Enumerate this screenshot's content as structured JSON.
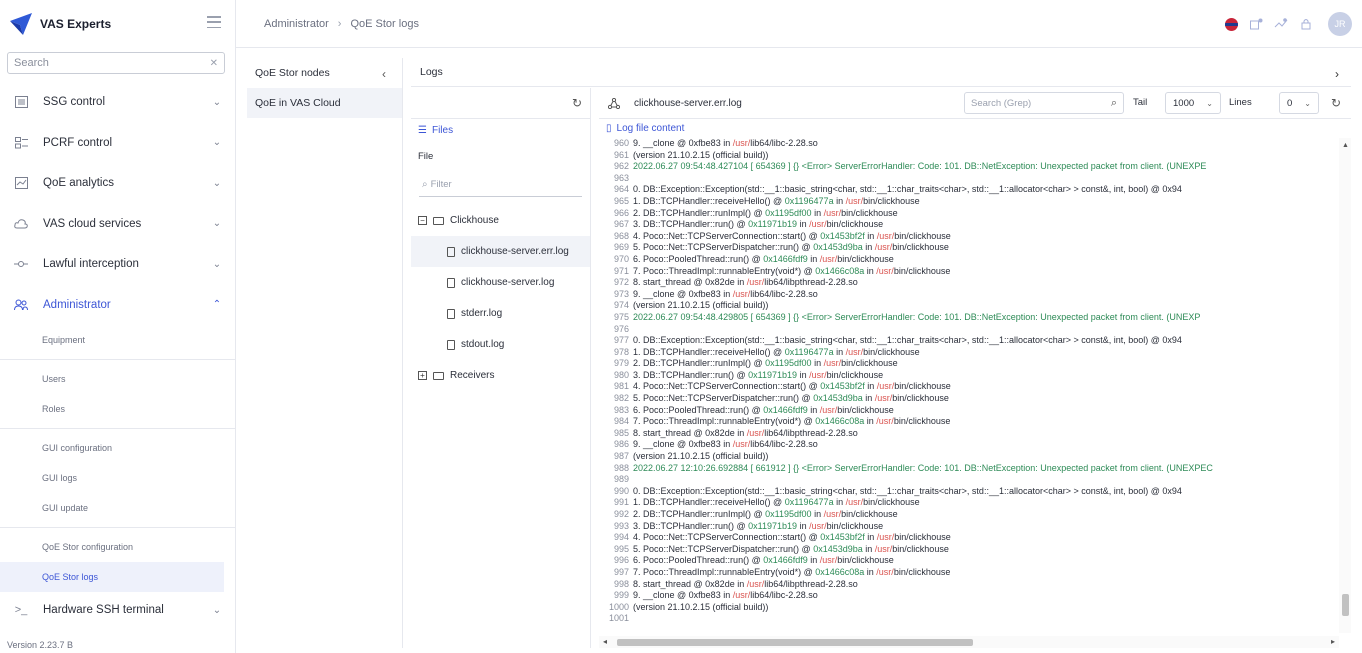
{
  "brand": {
    "name": "VAS Experts"
  },
  "sidebar": {
    "search_placeholder": "Search",
    "items": [
      {
        "label": "SSG control",
        "icon": "list-icon"
      },
      {
        "label": "PCRF control",
        "icon": "sliders-icon"
      },
      {
        "label": "QoE analytics",
        "icon": "chart-icon"
      },
      {
        "label": "VAS cloud services",
        "icon": "cloud-icon"
      },
      {
        "label": "Lawful interception",
        "icon": "signal-icon"
      },
      {
        "label": "Administrator",
        "icon": "users-icon"
      }
    ],
    "admin_sub": [
      {
        "label": "Equipment"
      },
      {
        "label": "Users"
      },
      {
        "label": "Roles"
      },
      {
        "label": "GUI configuration"
      },
      {
        "label": "GUI logs"
      },
      {
        "label": "GUI update"
      },
      {
        "label": "QoE Stor configuration"
      },
      {
        "label": "QoE Stor logs"
      }
    ],
    "terminal_label": "Hardware SSH terminal",
    "version": "Version 2.23.7 B"
  },
  "header": {
    "breadcrumb_parent": "Administrator",
    "breadcrumb_current": "QoE Stor logs",
    "avatar_initials": "JR"
  },
  "nodes": {
    "title": "QoE Stor nodes",
    "items": [
      "QoE in VAS Cloud"
    ]
  },
  "logs": {
    "title": "Logs",
    "files_tab": "Files",
    "file_label": "File",
    "filter_placeholder": "Filter",
    "tree": {
      "folder1": "Clickhouse",
      "files": [
        "clickhouse-server.err.log",
        "clickhouse-server.log",
        "stderr.log",
        "stdout.log"
      ],
      "folder2": "Receivers"
    },
    "viewer": {
      "file_name": "clickhouse-server.err.log",
      "grep_placeholder": "Search (Grep)",
      "tail_label": "Tail",
      "tail_value": "1000",
      "lines_label": "Lines",
      "lines_value": "0",
      "content_tab": "Log file content"
    }
  },
  "log_lines": [
    {
      "n": "960",
      "parts": [
        [
          "9. __clone @ 0xfbe83 in ",
          ""
        ],
        [
          "/usr/",
          "red"
        ],
        [
          "lib64/libc-2.28.so",
          ""
        ]
      ]
    },
    {
      "n": "961",
      "parts": [
        [
          "(version 21.10.2.15 (official build))",
          ""
        ]
      ]
    },
    {
      "n": "962",
      "parts": [
        [
          "2022.06.27 09:54:48.427104 [ 654369 ] {} <Error> ServerErrorHandler: Code: 101. DB::NetException: Unexpected packet from client. (UNEXPE",
          ""
        ]
      ]
    },
    {
      "n": "963",
      "parts": [
        [
          "",
          ""
        ]
      ]
    },
    {
      "n": "964",
      "parts": [
        [
          "0. DB::Exception::Exception(std::__1::basic_string<char, std::__1::char_traits<char>, std::__1::allocator<char> > const&, int, bool) @ 0x94",
          ""
        ]
      ]
    },
    {
      "n": "965",
      "parts": [
        [
          "1. DB::TCPHandler::receiveHello() @ ",
          ""
        ],
        [
          "0x1196477a",
          "green"
        ],
        [
          " in ",
          ""
        ],
        [
          "/usr/",
          "red"
        ],
        [
          "bin/clickhouse",
          ""
        ]
      ]
    },
    {
      "n": "966",
      "parts": [
        [
          "2. DB::TCPHandler::runImpl() @ ",
          ""
        ],
        [
          "0x1195df00",
          "green"
        ],
        [
          " in ",
          ""
        ],
        [
          "/usr/",
          "red"
        ],
        [
          "bin/clickhouse",
          ""
        ]
      ]
    },
    {
      "n": "967",
      "parts": [
        [
          "3. DB::TCPHandler::run() @ ",
          ""
        ],
        [
          "0x11971b19",
          "green"
        ],
        [
          " in ",
          ""
        ],
        [
          "/usr/",
          "red"
        ],
        [
          "bin/clickhouse",
          ""
        ]
      ]
    },
    {
      "n": "968",
      "parts": [
        [
          "4. Poco::Net::TCPServerConnection::start() @ ",
          ""
        ],
        [
          "0x1453bf2f",
          "green"
        ],
        [
          " in ",
          ""
        ],
        [
          "/usr/",
          "red"
        ],
        [
          "bin/clickhouse",
          ""
        ]
      ]
    },
    {
      "n": "969",
      "parts": [
        [
          "5. Poco::Net::TCPServerDispatcher::run() @ ",
          ""
        ],
        [
          "0x1453d9ba",
          "green"
        ],
        [
          " in ",
          ""
        ],
        [
          "/usr/",
          "red"
        ],
        [
          "bin/clickhouse",
          ""
        ]
      ]
    },
    {
      "n": "970",
      "parts": [
        [
          "6. Poco::PooledThread::run() @ ",
          ""
        ],
        [
          "0x1466fdf9",
          "green"
        ],
        [
          " in ",
          ""
        ],
        [
          "/usr/",
          "red"
        ],
        [
          "bin/clickhouse",
          ""
        ]
      ]
    },
    {
      "n": "971",
      "parts": [
        [
          "7. Poco::ThreadImpl::runnableEntry(void*) @ ",
          ""
        ],
        [
          "0x1466c08a",
          "green"
        ],
        [
          " in ",
          ""
        ],
        [
          "/usr/",
          "red"
        ],
        [
          "bin/clickhouse",
          ""
        ]
      ]
    },
    {
      "n": "972",
      "parts": [
        [
          "8. start_thread @ 0x82de in ",
          ""
        ],
        [
          "/usr/",
          "red"
        ],
        [
          "lib64/libpthread-2.28.so",
          ""
        ]
      ]
    },
    {
      "n": "973",
      "parts": [
        [
          "9. __clone @ 0xfbe83 in ",
          ""
        ],
        [
          "/usr/",
          "red"
        ],
        [
          "lib64/libc-2.28.so",
          ""
        ]
      ]
    },
    {
      "n": "974",
      "parts": [
        [
          "(version 21.10.2.15 (official build))",
          ""
        ]
      ]
    },
    {
      "n": "975",
      "parts": [
        [
          "2022.06.27 09:54:48.429805 [ 654369 ] {} <Error> ServerErrorHandler: Code: 101. DB::NetException: Unexpected packet from client. (UNEXP",
          ""
        ]
      ]
    },
    {
      "n": "976",
      "parts": [
        [
          "",
          ""
        ]
      ]
    },
    {
      "n": "977",
      "parts": [
        [
          "0. DB::Exception::Exception(std::__1::basic_string<char, std::__1::char_traits<char>, std::__1::allocator<char> > const&, int, bool) @ 0x94",
          ""
        ]
      ]
    },
    {
      "n": "978",
      "parts": [
        [
          "1. DB::TCPHandler::receiveHello() @ ",
          ""
        ],
        [
          "0x1196477a",
          "green"
        ],
        [
          " in ",
          ""
        ],
        [
          "/usr/",
          "red"
        ],
        [
          "bin/clickhouse",
          ""
        ]
      ]
    },
    {
      "n": "979",
      "parts": [
        [
          "2. DB::TCPHandler::runImpl() @ ",
          ""
        ],
        [
          "0x1195df00",
          "green"
        ],
        [
          " in ",
          ""
        ],
        [
          "/usr/",
          "red"
        ],
        [
          "bin/clickhouse",
          ""
        ]
      ]
    },
    {
      "n": "980",
      "parts": [
        [
          "3. DB::TCPHandler::run() @ ",
          ""
        ],
        [
          "0x11971b19",
          "green"
        ],
        [
          " in ",
          ""
        ],
        [
          "/usr/",
          "red"
        ],
        [
          "bin/clickhouse",
          ""
        ]
      ]
    },
    {
      "n": "981",
      "parts": [
        [
          "4. Poco::Net::TCPServerConnection::start() @ ",
          ""
        ],
        [
          "0x1453bf2f",
          "green"
        ],
        [
          " in ",
          ""
        ],
        [
          "/usr/",
          "red"
        ],
        [
          "bin/clickhouse",
          ""
        ]
      ]
    },
    {
      "n": "982",
      "parts": [
        [
          "5. Poco::Net::TCPServerDispatcher::run() @ ",
          ""
        ],
        [
          "0x1453d9ba",
          "green"
        ],
        [
          " in ",
          ""
        ],
        [
          "/usr/",
          "red"
        ],
        [
          "bin/clickhouse",
          ""
        ]
      ]
    },
    {
      "n": "983",
      "parts": [
        [
          "6. Poco::PooledThread::run() @ ",
          ""
        ],
        [
          "0x1466fdf9",
          "green"
        ],
        [
          " in ",
          ""
        ],
        [
          "/usr/",
          "red"
        ],
        [
          "bin/clickhouse",
          ""
        ]
      ]
    },
    {
      "n": "984",
      "parts": [
        [
          "7. Poco::ThreadImpl::runnableEntry(void*) @ ",
          ""
        ],
        [
          "0x1466c08a",
          "green"
        ],
        [
          " in ",
          ""
        ],
        [
          "/usr/",
          "red"
        ],
        [
          "bin/clickhouse",
          ""
        ]
      ]
    },
    {
      "n": "985",
      "parts": [
        [
          "8. start_thread @ 0x82de in ",
          ""
        ],
        [
          "/usr/",
          "red"
        ],
        [
          "lib64/libpthread-2.28.so",
          ""
        ]
      ]
    },
    {
      "n": "986",
      "parts": [
        [
          "9. __clone @ 0xfbe83 in ",
          ""
        ],
        [
          "/usr/",
          "red"
        ],
        [
          "lib64/libc-2.28.so",
          ""
        ]
      ]
    },
    {
      "n": "987",
      "parts": [
        [
          "(version 21.10.2.15 (official build))",
          ""
        ]
      ]
    },
    {
      "n": "988",
      "parts": [
        [
          "2022.06.27 12:10:26.692884 [ 661912 ] {} <Error> ServerErrorHandler: Code: 101. DB::NetException: Unexpected packet from client. (UNEXPEC",
          ""
        ]
      ]
    },
    {
      "n": "989",
      "parts": [
        [
          "",
          ""
        ]
      ]
    },
    {
      "n": "990",
      "parts": [
        [
          "0. DB::Exception::Exception(std::__1::basic_string<char, std::__1::char_traits<char>, std::__1::allocator<char> > const&, int, bool) @ 0x94",
          ""
        ]
      ]
    },
    {
      "n": "991",
      "parts": [
        [
          "1. DB::TCPHandler::receiveHello() @ ",
          ""
        ],
        [
          "0x1196477a",
          "green"
        ],
        [
          " in ",
          ""
        ],
        [
          "/usr/",
          "red"
        ],
        [
          "bin/clickhouse",
          ""
        ]
      ]
    },
    {
      "n": "992",
      "parts": [
        [
          "2. DB::TCPHandler::runImpl() @ ",
          ""
        ],
        [
          "0x1195df00",
          "green"
        ],
        [
          " in ",
          ""
        ],
        [
          "/usr/",
          "red"
        ],
        [
          "bin/clickhouse",
          ""
        ]
      ]
    },
    {
      "n": "993",
      "parts": [
        [
          "3. DB::TCPHandler::run() @ ",
          ""
        ],
        [
          "0x11971b19",
          "green"
        ],
        [
          " in ",
          ""
        ],
        [
          "/usr/",
          "red"
        ],
        [
          "bin/clickhouse",
          ""
        ]
      ]
    },
    {
      "n": "994",
      "parts": [
        [
          "4. Poco::Net::TCPServerConnection::start() @ ",
          ""
        ],
        [
          "0x1453bf2f",
          "green"
        ],
        [
          " in ",
          ""
        ],
        [
          "/usr/",
          "red"
        ],
        [
          "bin/clickhouse",
          ""
        ]
      ]
    },
    {
      "n": "995",
      "parts": [
        [
          "5. Poco::Net::TCPServerDispatcher::run() @ ",
          ""
        ],
        [
          "0x1453d9ba",
          "green"
        ],
        [
          " in ",
          ""
        ],
        [
          "/usr/",
          "red"
        ],
        [
          "bin/clickhouse",
          ""
        ]
      ]
    },
    {
      "n": "996",
      "parts": [
        [
          "6. Poco::PooledThread::run() @ ",
          ""
        ],
        [
          "0x1466fdf9",
          "green"
        ],
        [
          " in ",
          ""
        ],
        [
          "/usr/",
          "red"
        ],
        [
          "bin/clickhouse",
          ""
        ]
      ]
    },
    {
      "n": "997",
      "parts": [
        [
          "7. Poco::ThreadImpl::runnableEntry(void*) @ ",
          ""
        ],
        [
          "0x1466c08a",
          "green"
        ],
        [
          " in ",
          ""
        ],
        [
          "/usr/",
          "red"
        ],
        [
          "bin/clickhouse",
          ""
        ]
      ]
    },
    {
      "n": "998",
      "parts": [
        [
          "8. start_thread @ 0x82de in ",
          ""
        ],
        [
          "/usr/",
          "red"
        ],
        [
          "lib64/libpthread-2.28.so",
          ""
        ]
      ]
    },
    {
      "n": "999",
      "parts": [
        [
          "9. __clone @ 0xfbe83 in ",
          ""
        ],
        [
          "/usr/",
          "red"
        ],
        [
          "lib64/libc-2.28.so",
          ""
        ]
      ]
    },
    {
      "n": "1000",
      "parts": [
        [
          "(version 21.10.2.15 (official build))",
          ""
        ]
      ]
    },
    {
      "n": "1001",
      "parts": [
        [
          "",
          ""
        ]
      ]
    }
  ],
  "colors": {
    "accent": "#3d56d6",
    "hex_green": "#2e8b57",
    "path_red": "#d9534f"
  }
}
